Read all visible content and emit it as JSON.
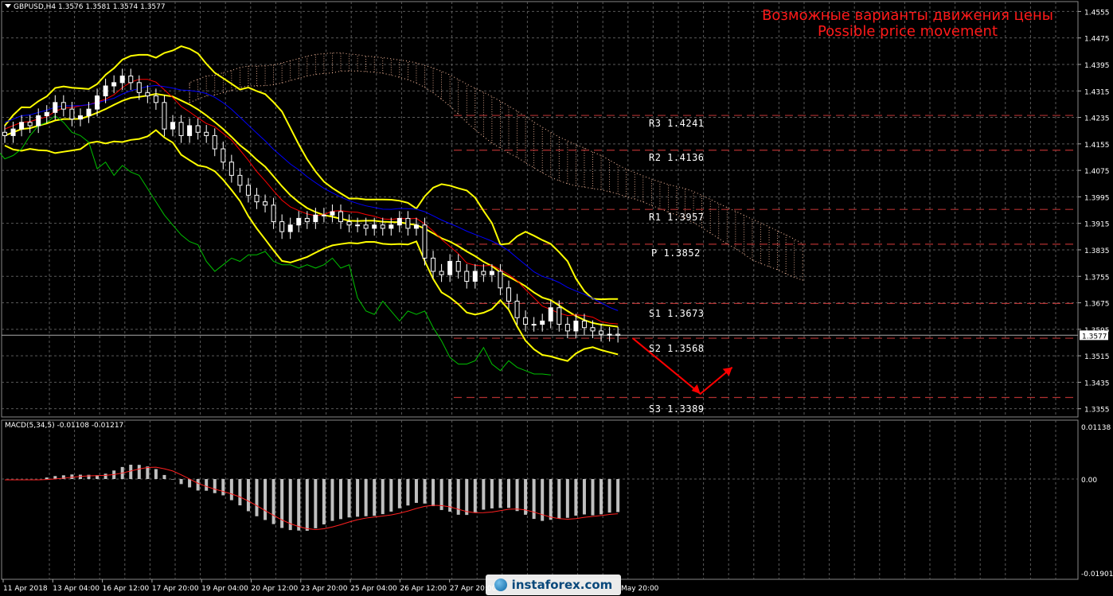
{
  "header": {
    "symbol": "GBPUSD,H4",
    "ohlc": "1.3576 1.3581 1.3574 1.3577"
  },
  "title": {
    "ru": "Возможные варианты движения цены",
    "en": "Possible price movement"
  },
  "macd": {
    "label": "MACD(5,34,5) -0.01108 -0.01217",
    "scale": [
      "0.01138",
      "0.00",
      "-0.01901"
    ]
  },
  "watermark": {
    "text": "instaforex.com"
  },
  "colors": {
    "background": "#000000",
    "grid": "#5a5a5a",
    "bollinger": "#ffff00",
    "kijun": "#ff0000",
    "tenkan": "#0000ff",
    "chikou": "#00c000",
    "cloud": "#ffbfa0",
    "levels": "#b03030",
    "candle": "#ffffff",
    "arrow": "#ff0000"
  },
  "chart_data": {
    "type": "candlestick",
    "symbol": "GBPUSD",
    "timeframe": "H4",
    "last_price": "1.3577",
    "price_axis": [
      "1.4555",
      "1.4475",
      "1.4395",
      "1.4315",
      "1.4235",
      "1.4155",
      "1.4075",
      "1.3995",
      "1.3915",
      "1.3835",
      "1.3755",
      "1.3675",
      "1.3595",
      "1.3515",
      "1.3435",
      "1.3355"
    ],
    "ylim": [
      1.3335,
      1.458
    ],
    "time_axis": [
      "11 Apr 2018",
      "13 Apr 04:00",
      "16 Apr 12:00",
      "17 Apr 20:00",
      "19 Apr 04:00",
      "20 Apr 12:00",
      "23 Apr 20:00",
      "25 Apr 04:00",
      "26 Apr 12:00",
      "27 Apr 20:00",
      "May 20:00"
    ],
    "levels": [
      {
        "name": "R3",
        "value": 1.4241,
        "label": "R3  1.4241"
      },
      {
        "name": "R2",
        "value": 1.4136,
        "label": "R2  1.4136"
      },
      {
        "name": "R1",
        "value": 1.3957,
        "label": "R1  1.3957"
      },
      {
        "name": "P",
        "value": 1.3852,
        "label": "P  1.3852"
      },
      {
        "name": "S1",
        "value": 1.3673,
        "label": "S1  1.3673"
      },
      {
        "name": "S2",
        "value": 1.3568,
        "label": "S2  1.3568"
      },
      {
        "name": "S3",
        "value": 1.3389,
        "label": "S3  1.3389"
      }
    ],
    "close_series": [
      1.418,
      1.42,
      1.422,
      1.421,
      1.424,
      1.425,
      1.428,
      1.426,
      1.423,
      1.424,
      1.426,
      1.43,
      1.433,
      1.434,
      1.436,
      1.434,
      1.431,
      1.43,
      1.428,
      1.42,
      1.422,
      1.418,
      1.421,
      1.419,
      1.418,
      1.414,
      1.41,
      1.406,
      1.403,
      1.4,
      1.398,
      1.397,
      1.392,
      1.389,
      1.391,
      1.393,
      1.392,
      1.394,
      1.394,
      1.395,
      1.392,
      1.391,
      1.391,
      1.39,
      1.391,
      1.39,
      1.391,
      1.393,
      1.39,
      1.391,
      1.381,
      1.377,
      1.376,
      1.38,
      1.377,
      1.374,
      1.377,
      1.376,
      1.377,
      1.372,
      1.368,
      1.363,
      1.361,
      1.361,
      1.362,
      1.366,
      1.361,
      1.359,
      1.362,
      1.36,
      1.359,
      1.358,
      1.358,
      1.3577
    ],
    "projection": [
      {
        "x": "after last bar",
        "y": 1.3568
      },
      {
        "x": "+2 days",
        "y": 1.34
      },
      {
        "x": "+3 days",
        "y": 1.348
      }
    ]
  }
}
